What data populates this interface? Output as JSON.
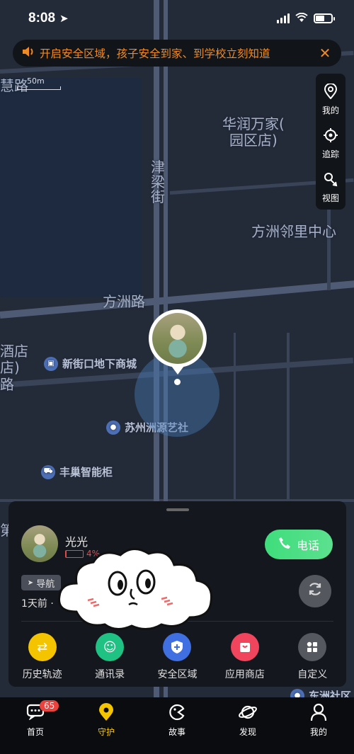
{
  "status_bar": {
    "time": "8:08"
  },
  "banner": {
    "text": "开启安全区域，孩子安全到家、到学校立刻知道",
    "close": "✕"
  },
  "map": {
    "scale": "50m",
    "labels": {
      "huirui": "慧路",
      "huarun": "华润万家(\n园区店)",
      "jinliang": "津\n梁\n街",
      "fangzhou_linli": "方洲邻里中心",
      "fangzhou_road": "方洲路",
      "jiudian": "酒店\n店)",
      "lu_left": "路",
      "di": "第"
    },
    "pois": {
      "xinjiekou": "新街口地下商城",
      "suzhou": "苏州洲源艺社",
      "fengchao": "丰巢智能柜",
      "dongzhou": "东洲社区"
    }
  },
  "tools": [
    {
      "icon": "location-pin-icon",
      "label": "我的"
    },
    {
      "icon": "crosshair-icon",
      "label": "追踪"
    },
    {
      "icon": "view-icon",
      "label": "视图"
    }
  ],
  "pet": {
    "name": "光光",
    "battery_percent": "4%",
    "nav_label": "导航",
    "last_seen": "1天前 ·",
    "call_label": "电话"
  },
  "quick_actions": [
    {
      "label": "历史轨迹",
      "color": "#f5c400",
      "glyph": "⇄"
    },
    {
      "label": "通讯录",
      "color": "#1fc283",
      "glyph": "☺"
    },
    {
      "label": "安全区域",
      "color": "#3f6fe0",
      "glyph": "+"
    },
    {
      "label": "应用商店",
      "color": "#f0455c",
      "glyph": "▭"
    },
    {
      "label": "自定义",
      "color": "#55585e",
      "glyph": "▦"
    }
  ],
  "tabs": [
    {
      "label": "首页",
      "icon": "chat-icon",
      "badge": "65"
    },
    {
      "label": "守护",
      "icon": "guard-pin-icon",
      "active": true
    },
    {
      "label": "故事",
      "icon": "story-icon"
    },
    {
      "label": "发现",
      "icon": "planet-icon"
    },
    {
      "label": "我的",
      "icon": "person-icon"
    }
  ]
}
